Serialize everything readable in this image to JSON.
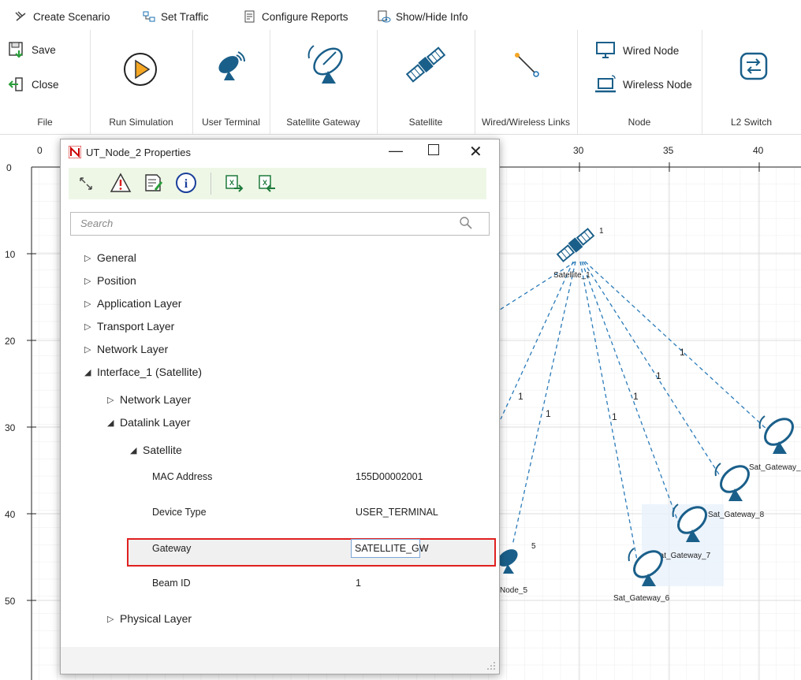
{
  "menubar": {
    "tabs": [
      {
        "label": "Create Scenario",
        "icon": "create-scenario-icon"
      },
      {
        "label": "Set Traffic",
        "icon": "set-traffic-icon"
      },
      {
        "label": "Configure Reports",
        "icon": "configure-reports-icon"
      },
      {
        "label": "Show/Hide Info",
        "icon": "show-hide-info-icon"
      }
    ]
  },
  "ribbon": {
    "file": {
      "save": "Save",
      "close": "Close",
      "group": "File"
    },
    "run_simulation": "Run Simulation",
    "user_terminal": "User Terminal",
    "satellite_gateway": "Satellite Gateway",
    "satellite": "Satellite",
    "links": "Wired/Wireless Links",
    "node": {
      "wired": "Wired Node",
      "wireless": "Wireless Node",
      "group": "Node"
    },
    "l2_switch": "L2 Switch"
  },
  "ruler": {
    "top": [
      "0",
      "30",
      "35",
      "40"
    ],
    "left": [
      "0",
      "10",
      "20",
      "30",
      "40",
      "50"
    ]
  },
  "canvas": {
    "nodes": {
      "satellite_1": "Satellite_1",
      "satellite_1_badge": "1",
      "gw_6": "Sat_Gateway_6",
      "gw_7": "Sat_Gateway_7",
      "gw_8": "Sat_Gateway_8",
      "gw_9": "Sat_Gateway_",
      "node_5": "Node_5",
      "node_5_badge": "5"
    },
    "link_labels": [
      "1",
      "1",
      "1",
      "1",
      "1",
      "1"
    ]
  },
  "dialog": {
    "title": "UT_Node_2 Properties",
    "search_placeholder": "Search",
    "tree": {
      "general": "General",
      "position": "Position",
      "application_layer": "Application Layer",
      "transport_layer": "Transport Layer",
      "network_layer": "Network Layer",
      "interface_1": "Interface_1 (Satellite)",
      "if_network_layer": "Network Layer",
      "datalink_layer": "Datalink Layer",
      "satellite": "Satellite",
      "physical_layer": "Physical Layer"
    },
    "props": [
      {
        "label": "MAC Address",
        "value": "155D00002001"
      },
      {
        "label": "Device Type",
        "value": "USER_TERMINAL"
      },
      {
        "label": "Gateway",
        "value": "SATELLITE_GW"
      },
      {
        "label": "Beam ID",
        "value": "1"
      }
    ]
  },
  "colors": {
    "accent": "#1a5f8a",
    "link": "#2b7bb9",
    "highlight": "#e02020"
  }
}
